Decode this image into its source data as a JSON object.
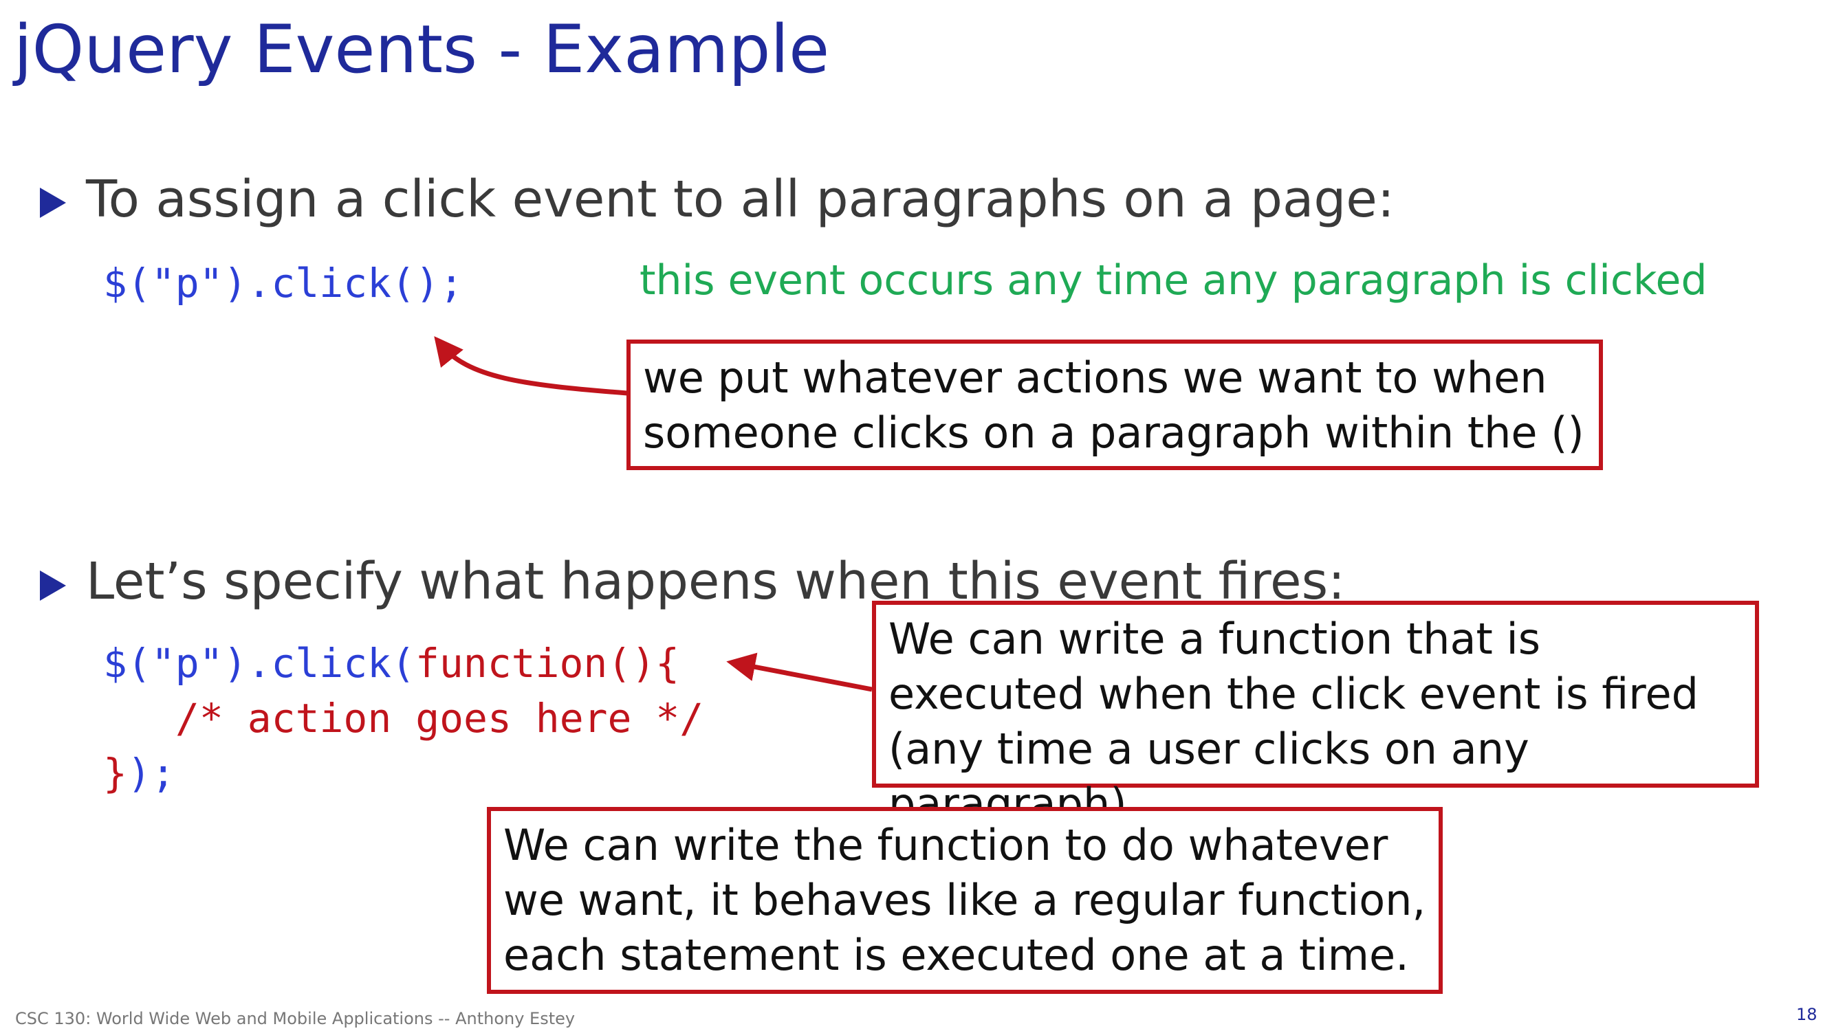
{
  "slide": {
    "title": "jQuery Events - Example",
    "bullet1": "To assign a click event to all paragraphs on a page:",
    "code1": "$(\"p\").click();",
    "note1": "this event occurs any time any paragraph is clicked",
    "callout1": "we put whatever actions we want to when someone clicks on a paragraph within the ()",
    "bullet2": "Let’s specify what happens when this event fires:",
    "code2": {
      "line1_prefix": "$(\"p\").click(",
      "line1_func": "function(){",
      "line2": "/* action goes here */",
      "line3_brace": "}",
      "line3_end": ");"
    },
    "callout2": "We can write a function that is executed when the click event is fired (any time a user clicks on any paragraph)",
    "callout3": "We can write the function to do whatever we want, it behaves like a regular function, each statement is executed one at a time.",
    "footer": "CSC 130: World Wide Web and Mobile Applications -- Anthony Estey",
    "page_number": "18"
  },
  "colors": {
    "title": "#1f2a9a",
    "code_blue": "#2b3fd6",
    "code_red": "#c0141c",
    "note_green": "#1faa55",
    "callout_border": "#c0141c"
  }
}
